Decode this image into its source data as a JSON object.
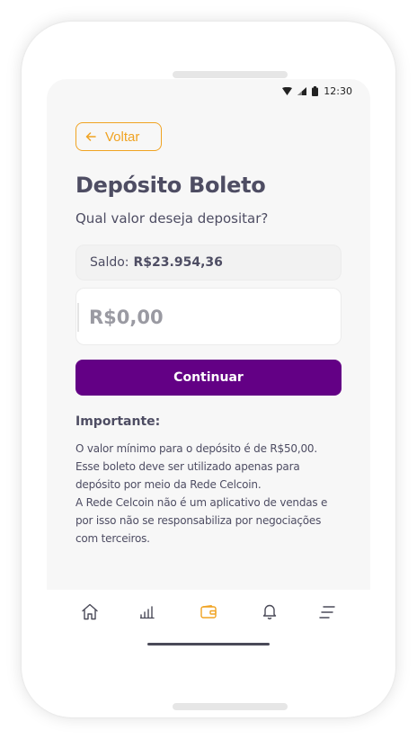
{
  "status_bar": {
    "time": "12:30"
  },
  "header": {
    "back_label": "Voltar"
  },
  "page": {
    "title": "Depósito Boleto",
    "question": "Qual valor deseja depositar?"
  },
  "balance": {
    "label": "Saldo:",
    "value": "R$23.954,36"
  },
  "amount_input": {
    "placeholder": "R$0,00"
  },
  "actions": {
    "continue_label": "Continuar"
  },
  "important": {
    "title": "Importante:",
    "lines": [
      "O valor mínimo para o depósito é de R$50,00.",
      "Esse boleto deve ser utilizado apenas para",
      "depósito por meio da Rede Celcoin.",
      "A Rede Celcoin não é um aplicativo de vendas e",
      "por isso não se responsabiliza por negociações",
      "com terceiros."
    ]
  },
  "bottom_nav": {
    "items": [
      {
        "icon": "home-icon"
      },
      {
        "icon": "chart-icon"
      },
      {
        "icon": "wallet-icon",
        "active": true
      },
      {
        "icon": "bell-icon"
      },
      {
        "icon": "menu-icon"
      }
    ]
  },
  "colors": {
    "accent": "#f0a322",
    "primary": "#630085",
    "text": "#4e4d63",
    "screen_bg": "#f7f7f7"
  }
}
